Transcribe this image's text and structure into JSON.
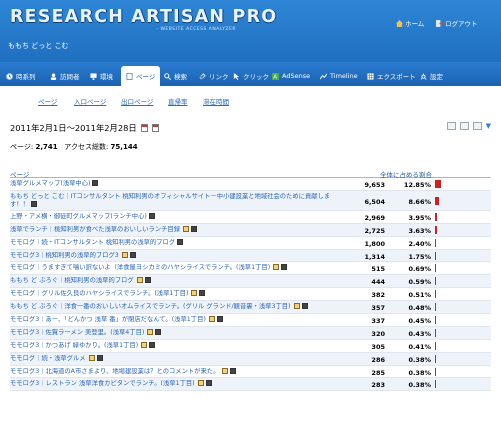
{
  "header": {
    "logo_title": "RESEARCH ARTISAN PRO",
    "logo_subtitle": "- WEBSITE ACCESS ANALYZER",
    "user_name": "ももち どっと こむ",
    "home_label": "ホーム",
    "logout_label": "ログアウト"
  },
  "nav": {
    "tabs": [
      {
        "label": "時系列",
        "icon": "clock-icon"
      },
      {
        "label": "訪問者",
        "icon": "users-icon"
      },
      {
        "label": "環境",
        "icon": "monitor-icon"
      },
      {
        "label": "ページ",
        "icon": "page-icon",
        "active": true
      },
      {
        "label": "検索",
        "icon": "search-icon"
      },
      {
        "label": "リンク",
        "icon": "link-icon"
      },
      {
        "label": "クリック",
        "icon": "cursor-icon"
      },
      {
        "label": "AdSense",
        "icon": "adsense-icon"
      },
      {
        "label": "Timeline",
        "icon": "timeline-icon"
      },
      {
        "label": "エクスポート",
        "icon": "export-icon"
      },
      {
        "label": "設定",
        "icon": "settings-icon"
      }
    ]
  },
  "subtabs": [
    "ページ",
    "入口ページ",
    "出口ページ",
    "直帰率",
    "滞在時間"
  ],
  "date_range": "2011年2月1日～2011年2月28日",
  "summary": {
    "pages_label": "ページ:",
    "pages_value": "2,741",
    "total_label": "アクセス総数:",
    "total_value": "75,144"
  },
  "table": {
    "col_page": "ページ",
    "col_share": "全体に占める割合",
    "rows": [
      {
        "title": "浅草グルメマップ(浅草中心)",
        "views": "9,653",
        "pct": "12.85%",
        "fraction": 0.1285,
        "icons": [
          "dark"
        ]
      },
      {
        "title": "ももち どっと こむ｜ITコンサルタント 桃知利男のオフィシャルサイト－中小建設業と地域社会のために貢献します！！",
        "views": "6,504",
        "pct": "8.66%",
        "fraction": 0.0866,
        "icons": [
          "dark"
        ],
        "tall": true
      },
      {
        "title": "上野・アメ横・御徒町グルメマップ(ランチ中心)",
        "views": "2,969",
        "pct": "3.95%",
        "fraction": 0.0395,
        "icons": [
          "dark"
        ]
      },
      {
        "title": "浅草でランチ｜桃知利男が食べた浅草のおいしいランチ目録",
        "views": "2,725",
        "pct": "3.63%",
        "fraction": 0.0363,
        "icons": [
          "yellow",
          "dark"
        ]
      },
      {
        "title": "モモログ｜続・ITコンサルタント 桃知利男の浅草的ブログ",
        "views": "1,800",
        "pct": "2.40%",
        "fraction": 0.024,
        "icons": [
          "dark"
        ]
      },
      {
        "title": "モモログ3｜桃知利男の浅草的ブログ3",
        "views": "1,314",
        "pct": "1.75%",
        "fraction": 0.0175,
        "icons": [
          "yellow",
          "dark"
        ]
      },
      {
        "title": "モモログ｜うますぎて噛い訳ないよ（洋食屋ヨシカミのハヤシライスでランチ。(浅草1丁目)",
        "views": "515",
        "pct": "0.69%",
        "fraction": 0.0069,
        "icons": [
          "yellow",
          "dark"
        ]
      },
      {
        "title": "ももち ど ぶろぐ｜桃知利男の浅草的ブログ",
        "views": "444",
        "pct": "0.59%",
        "fraction": 0.0059,
        "icons": [
          "yellow",
          "dark"
        ]
      },
      {
        "title": "モモログ｜グリル佐久良のハヤシライスでランチ。(浅草1丁目)",
        "views": "382",
        "pct": "0.51%",
        "fraction": 0.0051,
        "icons": [
          "yellow",
          "dark"
        ]
      },
      {
        "title": "ももち ど ぶろぐ｜洋食一番のおいしいオムライスでランチ。(グリル グランド/観音裏・浅草3丁目)",
        "views": "357",
        "pct": "0.48%",
        "fraction": 0.0048,
        "icons": [
          "yellow",
          "dark"
        ]
      },
      {
        "title": "モモログ3｜あー、「どんかつ 浅草 番」が閉店だなんて。(浅草1丁目)",
        "views": "337",
        "pct": "0.45%",
        "fraction": 0.0045,
        "icons": [
          "yellow",
          "dark"
        ]
      },
      {
        "title": "モモログ3｜佐賀ラーメン 美登里。(浅草4丁目)",
        "views": "320",
        "pct": "0.43%",
        "fraction": 0.0043,
        "icons": [
          "yellow",
          "dark"
        ]
      },
      {
        "title": "モモログ3｜かつあげ 緑ゆかり。(浅草1丁目)",
        "views": "305",
        "pct": "0.41%",
        "fraction": 0.0041,
        "icons": [
          "yellow",
          "dark"
        ]
      },
      {
        "title": "モモログ｜続・浅草グルメ",
        "views": "286",
        "pct": "0.38%",
        "fraction": 0.0038,
        "icons": [
          "yellow",
          "dark"
        ]
      },
      {
        "title": "モモログ3｜北海道のA市さまより、地場建設業は？とのコメントが来た。",
        "views": "285",
        "pct": "0.38%",
        "fraction": 0.0038,
        "icons": [
          "yellow",
          "dark"
        ]
      },
      {
        "title": "モモログ3｜レストラン 浅草洋食カピタンでランチ。(浅草1丁目)",
        "views": "283",
        "pct": "0.38%",
        "fraction": 0.0038,
        "icons": [
          "yellow",
          "dark"
        ]
      }
    ]
  },
  "colors": {
    "header_blue": "#1f6fc0",
    "link_blue": "#2a62b8",
    "bar_red": "#d21f1f"
  }
}
